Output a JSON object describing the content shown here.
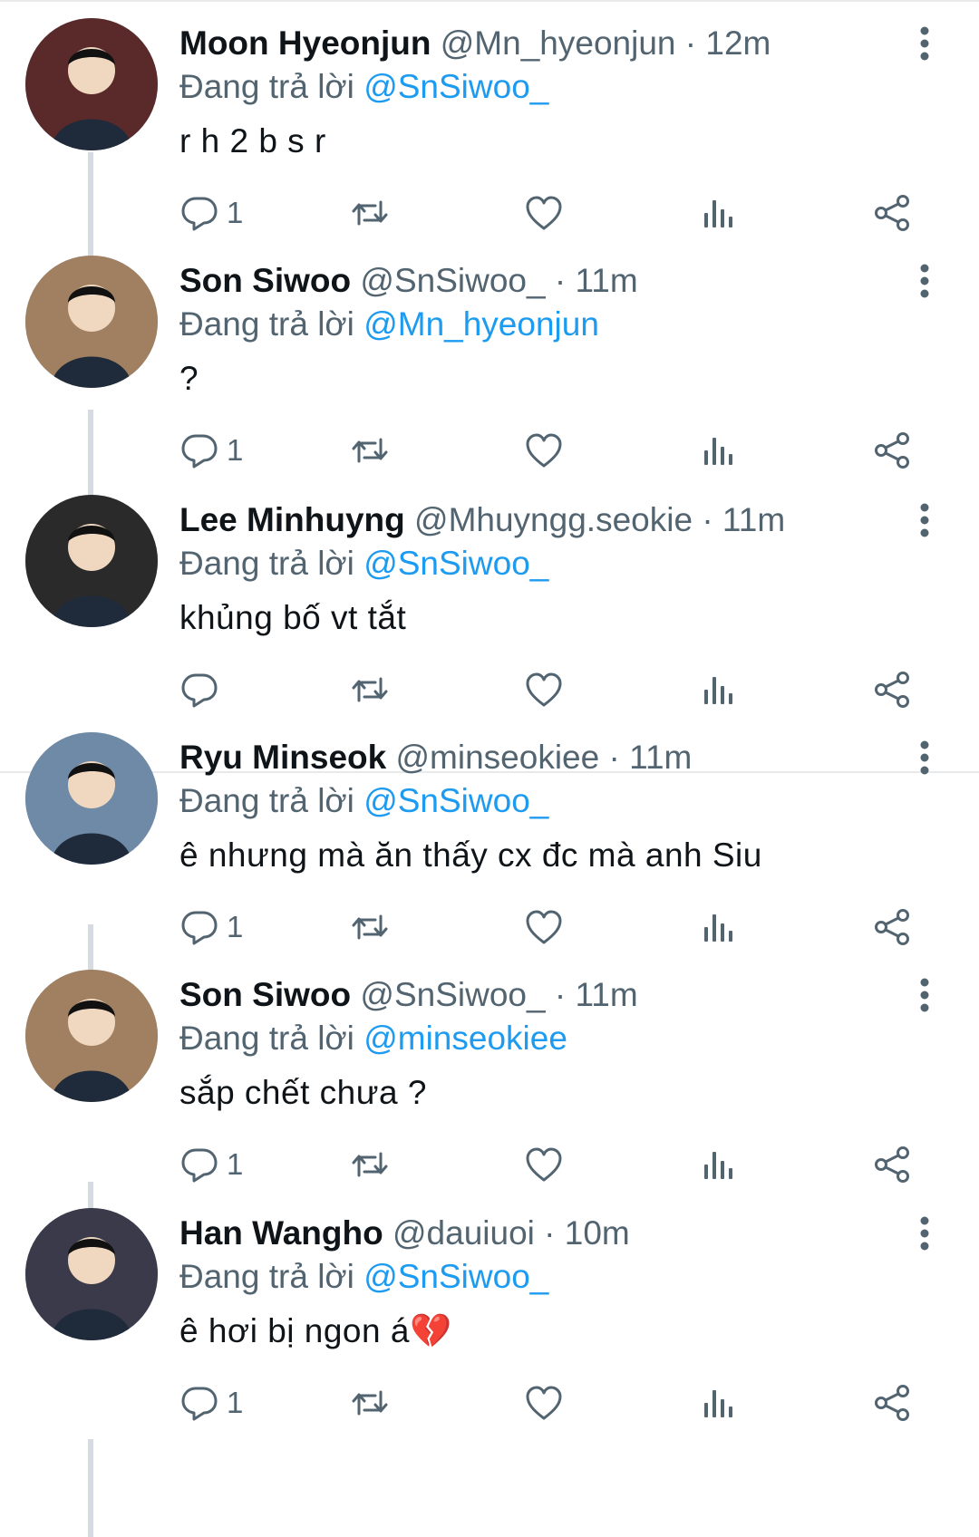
{
  "tweets": [
    {
      "name": "Moon Hyeonjun",
      "handle": "@Mn_hyeonjun",
      "sep": "·",
      "time": "12m",
      "reply_prefix": "Đang trả lời",
      "reply_to": "@SnSiwoo_",
      "text": "r h 2 b s r",
      "reply_count": "1",
      "avatar_color": "#5a2a2a"
    },
    {
      "name": "Son Siwoo",
      "handle": "@SnSiwoo_",
      "sep": "·",
      "time": "11m",
      "reply_prefix": "Đang trả lời",
      "reply_to": "@Mn_hyeonjun",
      "text": "?",
      "reply_count": "1",
      "avatar_color": "#a08060"
    },
    {
      "name": "Lee Minhuyng",
      "handle": "@Mhuyngg.seokie",
      "sep": "·",
      "time": "11m",
      "reply_prefix": "Đang trả lời",
      "reply_to": "@SnSiwoo_",
      "text": "khủng bố vt tắt",
      "reply_count": "",
      "avatar_color": "#2a2a2a"
    },
    {
      "name": "Ryu Minseok",
      "handle": "@minseokiee",
      "sep": "·",
      "time": "11m",
      "reply_prefix": "Đang trả lời",
      "reply_to": "@SnSiwoo_",
      "text": "ê nhưng mà ăn thấy cx đc mà anh Siu",
      "reply_count": "1",
      "avatar_color": "#6f8aa6"
    },
    {
      "name": "Son Siwoo",
      "handle": "@SnSiwoo_",
      "sep": "·",
      "time": "11m",
      "reply_prefix": "Đang trả lời",
      "reply_to": "@minseokiee",
      "text": "sắp chết chưa ?",
      "reply_count": "1",
      "avatar_color": "#a08060"
    },
    {
      "name": "Han Wangho",
      "handle": "@dauiuoi",
      "sep": "·",
      "time": "10m",
      "reply_prefix": "Đang trả lời",
      "reply_to": "@SnSiwoo_",
      "text": "ê hơi bị ngon á💔",
      "reply_count": "1",
      "avatar_color": "#3a3a4a"
    }
  ],
  "colors": {
    "accent": "#1d9bf0",
    "secondary_text": "#536471",
    "thread_line": "#d5dbe0"
  },
  "icons": [
    "reply-icon",
    "retweet-icon",
    "like-icon",
    "views-icon",
    "share-icon",
    "more-icon"
  ]
}
